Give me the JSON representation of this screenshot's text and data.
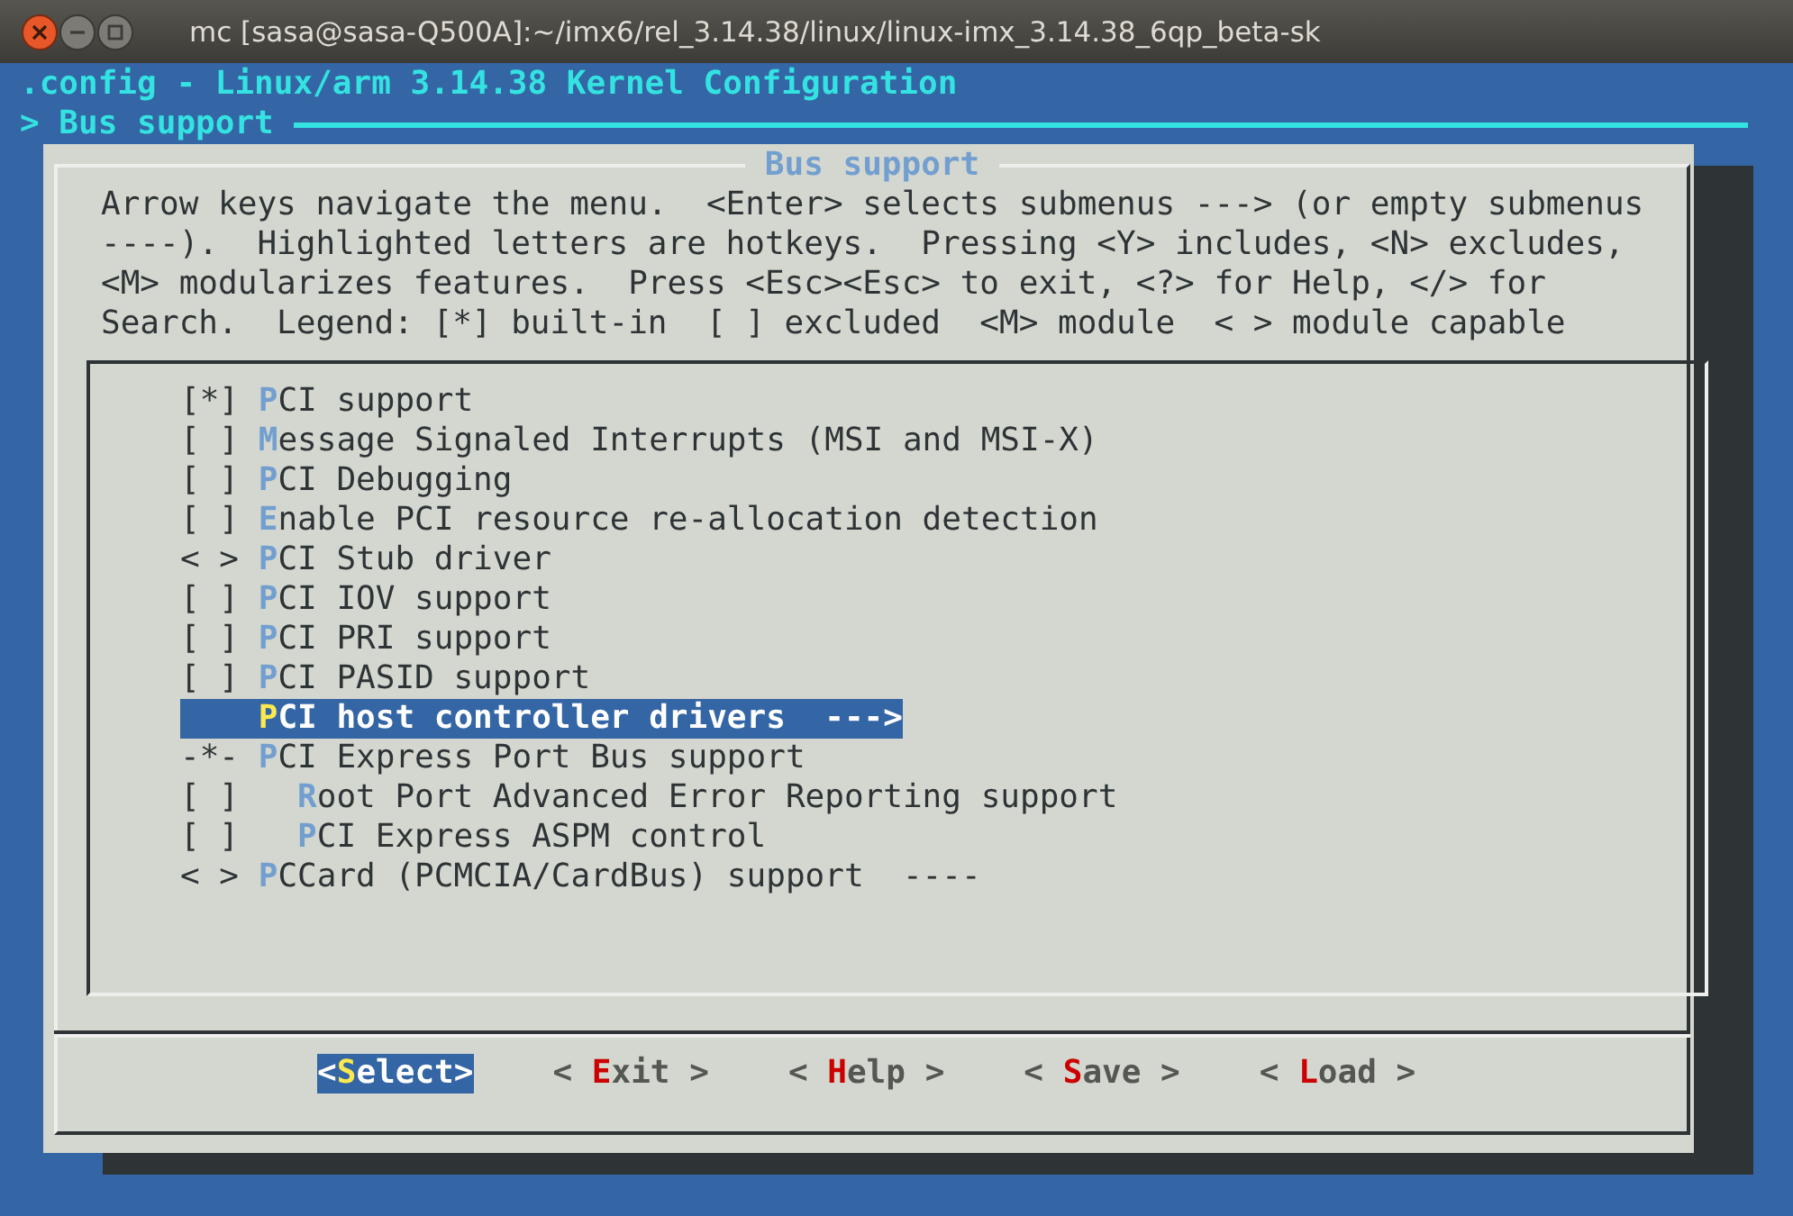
{
  "window": {
    "title": "mc [sasa@sasa-Q500A]:~/imx6/rel_3.14.38/linux/linux-imx_3.14.38_6qp_beta-sk"
  },
  "header": {
    "config_title": ".config - Linux/arm 3.14.38 Kernel Configuration",
    "breadcrumb": "> Bus support"
  },
  "dialog": {
    "title": "Bus support",
    "help_text": "Arrow keys navigate the menu.  <Enter> selects submenus ---> (or empty submenus\n----).  Highlighted letters are hotkeys.  Pressing <Y> includes, <N> excludes,\n<M> modularizes features.  Press <Esc><Esc> to exit, <?> for Help, </> for\nSearch.  Legend: [*] built-in  [ ] excluded  <M> module  < > module capable"
  },
  "menu_items": [
    {
      "prefix": "[*]",
      "hotkey": "P",
      "rest": "CI support",
      "selected": false
    },
    {
      "prefix": "[ ]",
      "hotkey": "M",
      "rest": "essage Signaled Interrupts (MSI and MSI-X)",
      "selected": false
    },
    {
      "prefix": "[ ]",
      "hotkey": "P",
      "rest": "CI Debugging",
      "selected": false
    },
    {
      "prefix": "[ ]",
      "hotkey": "E",
      "rest": "nable PCI resource re-allocation detection",
      "selected": false
    },
    {
      "prefix": "< >",
      "hotkey": "P",
      "rest": "CI Stub driver",
      "selected": false
    },
    {
      "prefix": "[ ]",
      "hotkey": "P",
      "rest": "CI IOV support",
      "selected": false
    },
    {
      "prefix": "[ ]",
      "hotkey": "P",
      "rest": "CI PRI support",
      "selected": false
    },
    {
      "prefix": "[ ]",
      "hotkey": "P",
      "rest": "CI PASID support",
      "selected": false
    },
    {
      "hotkey": "P",
      "rest": "CI host controller drivers  --->",
      "selected": true
    },
    {
      "prefix": "-*-",
      "hotkey": "P",
      "rest": "CI Express Port Bus support",
      "selected": false,
      "children": [
        {
          "prefix": "[ ]",
          "hotkey": "R",
          "rest": "oot Port Advanced Error Reporting support",
          "selected": false
        },
        {
          "prefix": "[ ]",
          "hotkey": "P",
          "rest": "CI Express ASPM control",
          "selected": false
        }
      ]
    },
    {
      "prefix": "< >",
      "hotkey": "P",
      "rest": "CCard (PCMCIA/CardBus) support  ----",
      "selected": false
    }
  ],
  "buttons": [
    {
      "before": "<",
      "hotkey": "S",
      "rest": "elect>",
      "selected": true
    },
    {
      "before": "< ",
      "hotkey": "E",
      "rest": "xit >",
      "selected": false
    },
    {
      "before": "< ",
      "hotkey": "H",
      "rest": "elp >",
      "selected": false
    },
    {
      "before": "< ",
      "hotkey": "S",
      "rest": "ave >",
      "selected": false
    },
    {
      "before": "< ",
      "hotkey": "L",
      "rest": "oad >",
      "selected": false
    }
  ]
}
